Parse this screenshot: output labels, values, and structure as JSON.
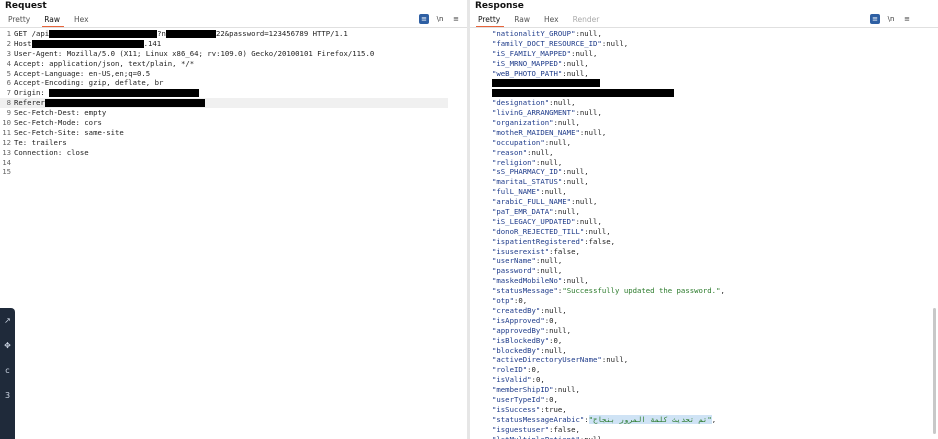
{
  "request": {
    "title": "Request",
    "tabs": [
      {
        "label": "Pretty"
      },
      {
        "label": "Raw"
      },
      {
        "label": "Hex"
      }
    ],
    "active_tab": "Raw",
    "tools": [
      {
        "icon": "wrap-lines-icon",
        "label": "≡"
      },
      {
        "icon": "newline-icon",
        "label": "\\n"
      },
      {
        "icon": "menu-icon",
        "label": "≡"
      }
    ],
    "lines": [
      {
        "n": "1",
        "parts": [
          {
            "t": "GET /api"
          },
          {
            "redact": 108
          },
          {
            "t": "?n"
          },
          {
            "redact": 50
          },
          {
            "t": "22&password=123456789 HTTP/1.1"
          }
        ]
      },
      {
        "n": "2",
        "parts": [
          {
            "t": "Host"
          },
          {
            "redact": 112
          },
          {
            "t": ".141"
          }
        ]
      },
      {
        "n": "3",
        "parts": [
          {
            "t": "User-Agent: Mozilla/5.0 (X11; Linux x86_64; rv:109.0) Gecko/20100101 Firefox/115.0"
          }
        ]
      },
      {
        "n": "4",
        "parts": [
          {
            "t": "Accept: application/json, text/plain, */*"
          }
        ]
      },
      {
        "n": "5",
        "parts": [
          {
            "t": "Accept-Language: en-US,en;q=0.5"
          }
        ]
      },
      {
        "n": "6",
        "parts": [
          {
            "t": "Accept-Encoding: gzip, deflate, br"
          }
        ]
      },
      {
        "n": "7",
        "parts": [
          {
            "t": "Origin: "
          },
          {
            "redact": 150
          }
        ]
      },
      {
        "n": "8",
        "parts": [
          {
            "t": "Referer"
          },
          {
            "redact": 160
          }
        ],
        "hl": true
      },
      {
        "n": "9",
        "parts": [
          {
            "t": "Sec-Fetch-Dest: empty"
          }
        ]
      },
      {
        "n": "10",
        "parts": [
          {
            "t": "Sec-Fetch-Mode: cors"
          }
        ]
      },
      {
        "n": "11",
        "parts": [
          {
            "t": "Sec-Fetch-Site: same-site"
          }
        ]
      },
      {
        "n": "12",
        "parts": [
          {
            "t": "Te: trailers"
          }
        ]
      },
      {
        "n": "13",
        "parts": [
          {
            "t": "Connection: close"
          }
        ]
      },
      {
        "n": "14",
        "parts": []
      },
      {
        "n": "15",
        "parts": []
      }
    ]
  },
  "response": {
    "title": "Response",
    "tabs": [
      {
        "label": "Pretty"
      },
      {
        "label": "Raw"
      },
      {
        "label": "Hex"
      },
      {
        "label": "Render"
      }
    ],
    "active_tab": "Pretty",
    "tools": [
      {
        "icon": "wrap-lines-icon",
        "label": "≡"
      },
      {
        "icon": "newline-icon",
        "label": "\\n"
      },
      {
        "icon": "menu-icon",
        "label": "≡"
      }
    ],
    "lines": [
      {
        "parts": [
          {
            "k": "\"nationalitY_GROUP\""
          },
          {
            "t": ":null,"
          }
        ]
      },
      {
        "parts": [
          {
            "k": "\"familY_DOCT_RESOURCE_ID\""
          },
          {
            "t": ":null,"
          }
        ]
      },
      {
        "parts": [
          {
            "k": "\"iS_FAMILY_MAPPED\""
          },
          {
            "t": ":null,"
          }
        ]
      },
      {
        "parts": [
          {
            "k": "\"iS_MRNO_MAPPED\""
          },
          {
            "t": ":null,"
          }
        ]
      },
      {
        "parts": [
          {
            "k": "\"weB_PHOTO_PATH\""
          },
          {
            "t": ":null,"
          }
        ]
      },
      {
        "parts": [
          {
            "redact": 108
          }
        ]
      },
      {
        "parts": [
          {
            "redact": 182
          }
        ]
      },
      {
        "parts": [
          {
            "k": "\"designation\""
          },
          {
            "t": ":null,"
          }
        ]
      },
      {
        "parts": [
          {
            "k": "\"livinG_ARRANGMENT\""
          },
          {
            "t": ":null,"
          }
        ]
      },
      {
        "parts": [
          {
            "k": "\"organization\""
          },
          {
            "t": ":null,"
          }
        ]
      },
      {
        "parts": [
          {
            "k": "\"motheR_MAIDEN_NAME\""
          },
          {
            "t": ":null,"
          }
        ]
      },
      {
        "parts": [
          {
            "k": "\"occupation\""
          },
          {
            "t": ":null,"
          }
        ]
      },
      {
        "parts": [
          {
            "k": "\"reason\""
          },
          {
            "t": ":null,"
          }
        ]
      },
      {
        "parts": [
          {
            "k": "\"religion\""
          },
          {
            "t": ":null,"
          }
        ]
      },
      {
        "parts": [
          {
            "k": "\"sS_PHARMACY_ID\""
          },
          {
            "t": ":null,"
          }
        ]
      },
      {
        "parts": [
          {
            "k": "\"maritaL_STATUS\""
          },
          {
            "t": ":null,"
          }
        ]
      },
      {
        "parts": [
          {
            "k": "\"fulL_NAME\""
          },
          {
            "t": ":null,"
          }
        ]
      },
      {
        "parts": [
          {
            "k": "\"arabiC_FULL_NAME\""
          },
          {
            "t": ":null,"
          }
        ]
      },
      {
        "parts": [
          {
            "k": "\"paT_EMR_DATA\""
          },
          {
            "t": ":null,"
          }
        ]
      },
      {
        "parts": [
          {
            "k": "\"iS_LEGACY_UPDATED\""
          },
          {
            "t": ":null,"
          }
        ]
      },
      {
        "parts": [
          {
            "k": "\"donoR_REJECTED_TILL\""
          },
          {
            "t": ":null,"
          }
        ]
      },
      {
        "parts": [
          {
            "k": "\"ispatientRegistered\""
          },
          {
            "t": ":false,"
          }
        ]
      },
      {
        "parts": [
          {
            "k": "\"isuserexist\""
          },
          {
            "t": ":false,"
          }
        ]
      },
      {
        "parts": [
          {
            "k": "\"userName\""
          },
          {
            "t": ":null,"
          }
        ]
      },
      {
        "parts": [
          {
            "k": "\"password\""
          },
          {
            "t": ":null,"
          }
        ]
      },
      {
        "parts": [
          {
            "k": "\"maskedMobileNo\""
          },
          {
            "t": ":null,"
          }
        ]
      },
      {
        "parts": [
          {
            "k": "\"statusMessage\""
          },
          {
            "t": ":"
          },
          {
            "s": "\"Successfully updated the password.\""
          },
          {
            "t": ","
          }
        ]
      },
      {
        "parts": [
          {
            "k": "\"otp\""
          },
          {
            "t": ":0,"
          }
        ]
      },
      {
        "parts": [
          {
            "k": "\"createdBy\""
          },
          {
            "t": ":null,"
          }
        ]
      },
      {
        "parts": [
          {
            "k": "\"isApproved\""
          },
          {
            "t": ":0,"
          }
        ]
      },
      {
        "parts": [
          {
            "k": "\"approvedBy\""
          },
          {
            "t": ":null,"
          }
        ]
      },
      {
        "parts": [
          {
            "k": "\"isBlockedBy\""
          },
          {
            "t": ":0,"
          }
        ]
      },
      {
        "parts": [
          {
            "k": "\"blockedBy\""
          },
          {
            "t": ":null,"
          }
        ]
      },
      {
        "parts": [
          {
            "k": "\"activeDirectoryUserName\""
          },
          {
            "t": ":null,"
          }
        ]
      },
      {
        "parts": [
          {
            "k": "\"roleID\""
          },
          {
            "t": ":0,"
          }
        ]
      },
      {
        "parts": [
          {
            "k": "\"isValid\""
          },
          {
            "t": ":0,"
          }
        ]
      },
      {
        "parts": [
          {
            "k": "\"memberShipID\""
          },
          {
            "t": ":null,"
          }
        ]
      },
      {
        "parts": [
          {
            "k": "\"userTypeId\""
          },
          {
            "t": ":0,"
          }
        ]
      },
      {
        "parts": [
          {
            "k": "\"isSuccess\""
          },
          {
            "t": ":true,"
          }
        ]
      },
      {
        "parts": [
          {
            "k": "\"statusMessageArabic\""
          },
          {
            "t": ":"
          },
          {
            "s": "\"تم تحديث كلمة المرور بنجاح\"",
            "sel": true
          },
          {
            "t": ","
          }
        ]
      },
      {
        "parts": [
          {
            "k": "\"isguestuser\""
          },
          {
            "t": ":false,"
          }
        ]
      },
      {
        "parts": [
          {
            "k": "\"lstMultiplePatient\""
          },
          {
            "t": ":null"
          }
        ]
      }
    ]
  },
  "side_widget": {
    "icons": [
      {
        "icon": "expand-icon",
        "label": "↗"
      },
      {
        "icon": "move-icon",
        "label": "✥"
      },
      {
        "icon": "copy-icon",
        "label": "c"
      },
      {
        "icon": "code-icon",
        "label": "3"
      }
    ]
  }
}
